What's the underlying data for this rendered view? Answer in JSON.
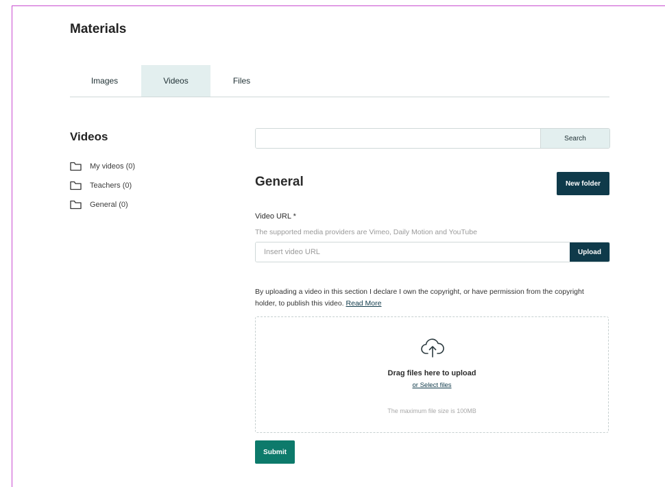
{
  "page": {
    "title": "Materials"
  },
  "tabs": [
    {
      "label": "Images",
      "active": false
    },
    {
      "label": "Videos",
      "active": true
    },
    {
      "label": "Files",
      "active": false
    }
  ],
  "sidebar": {
    "title": "Videos",
    "folders": [
      {
        "label": "My videos (0)",
        "icon": "folder-icon"
      },
      {
        "label": "Teachers (0)",
        "icon": "folder-icon"
      },
      {
        "label": "General (0)",
        "icon": "folder-icon"
      }
    ]
  },
  "search": {
    "value": "",
    "placeholder": "",
    "button_label": "Search"
  },
  "section": {
    "title": "General",
    "new_folder_label": "New folder"
  },
  "video_url": {
    "label": "Video URL *",
    "help": "The supported media providers are Vimeo, Daily Motion and YouTube",
    "placeholder": "Insert video URL",
    "value": "",
    "upload_label": "Upload"
  },
  "disclaimer": {
    "text": "By uploading a video in this section I declare I own the copyright, or have permission from the copyright holder, to publish this video.",
    "link_label": "Read More"
  },
  "dropzone": {
    "icon": "cloud-upload-icon",
    "title": "Drag files here to upload",
    "select_label": "or Select files",
    "max_size": "The maximum file size is 100MB"
  },
  "submit_label": "Submit",
  "colors": {
    "primary_dark": "#0f3a4a",
    "submit_green": "#0d7a6b",
    "tab_active_bg": "#e3efef",
    "frame_accent": "#c84bd0"
  }
}
